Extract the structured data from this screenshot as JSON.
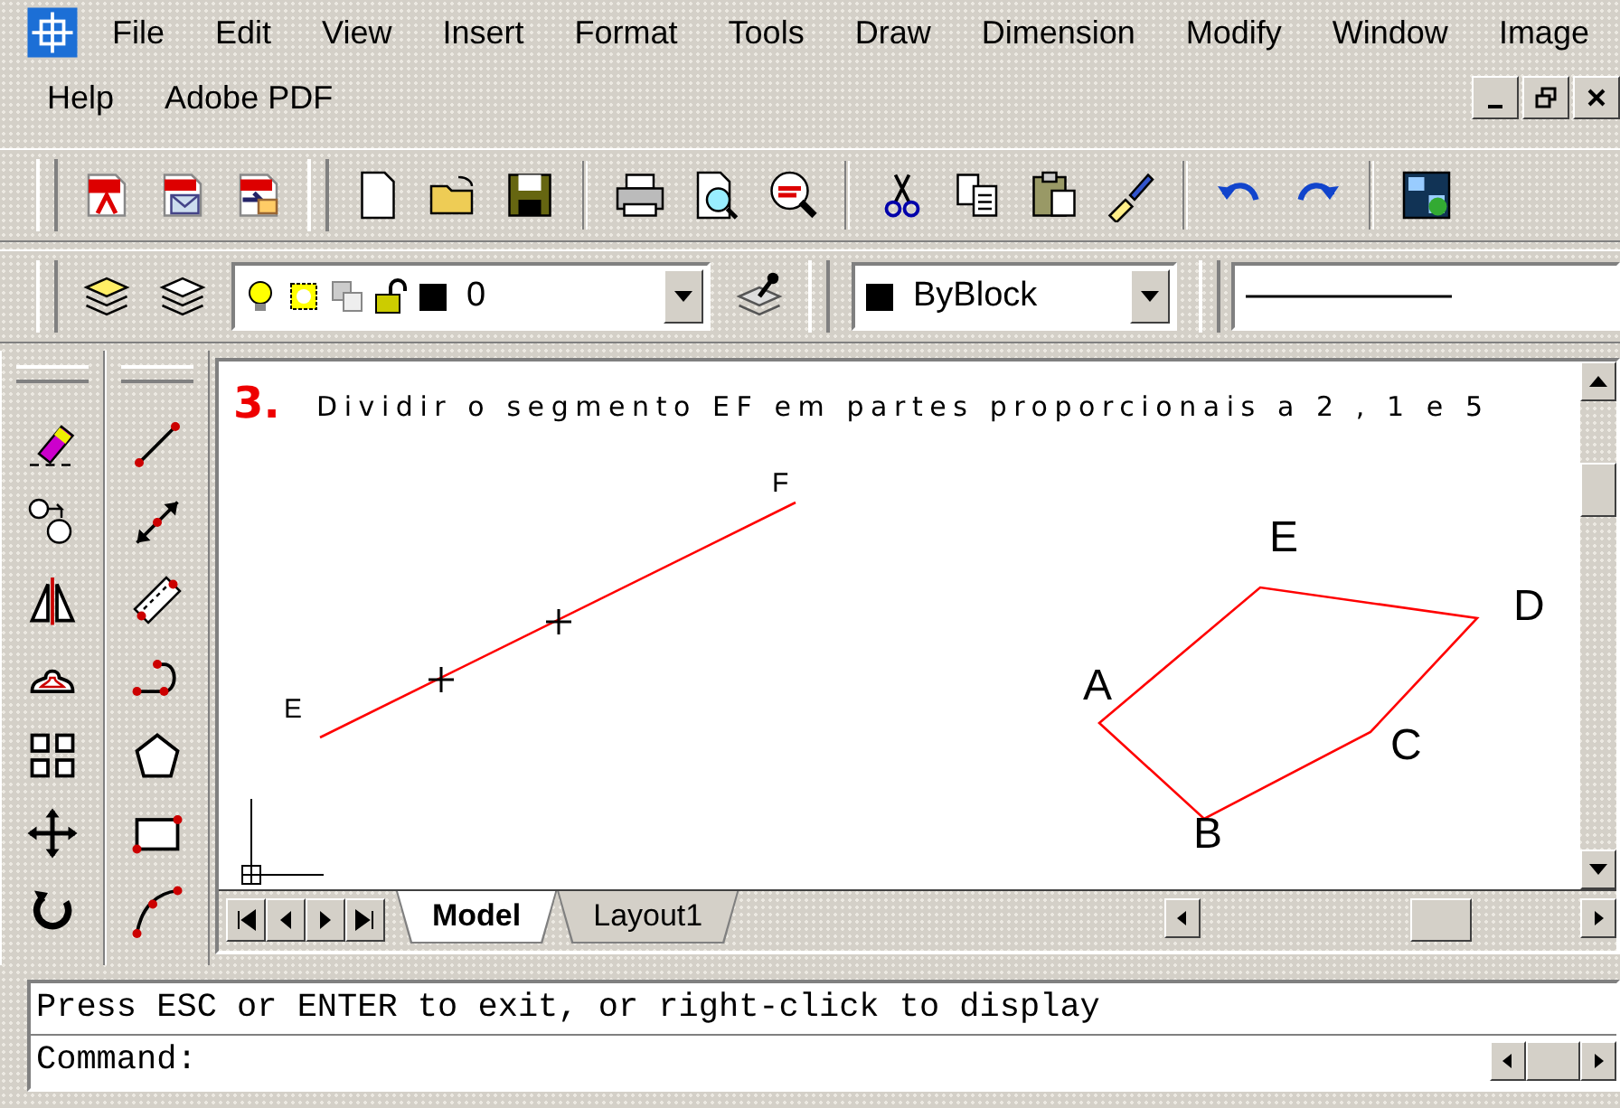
{
  "menu_bar": {
    "items": [
      "File",
      "Edit",
      "View",
      "Insert",
      "Format",
      "Tools",
      "Draw",
      "Dimension",
      "Modify",
      "Window",
      "Image",
      "Help",
      "Adobe PDF"
    ]
  },
  "layers_toolbar": {
    "layer": "0",
    "color_setting": "ByBlock"
  },
  "drawing": {
    "number": "3.",
    "instruction": "Dividir o segmento EF em partes proporcionais a 2 , 1 e 5",
    "labels": [
      "F",
      "E",
      "E",
      "D",
      "A",
      "C",
      "B"
    ]
  },
  "layout_tabs": [
    {
      "label": "Model",
      "selected": true
    },
    {
      "label": "Layout1",
      "selected": false
    }
  ],
  "command_line": {
    "lines": [
      "Press ESC or ENTER to exit, or right-click to display",
      "Command:"
    ]
  }
}
